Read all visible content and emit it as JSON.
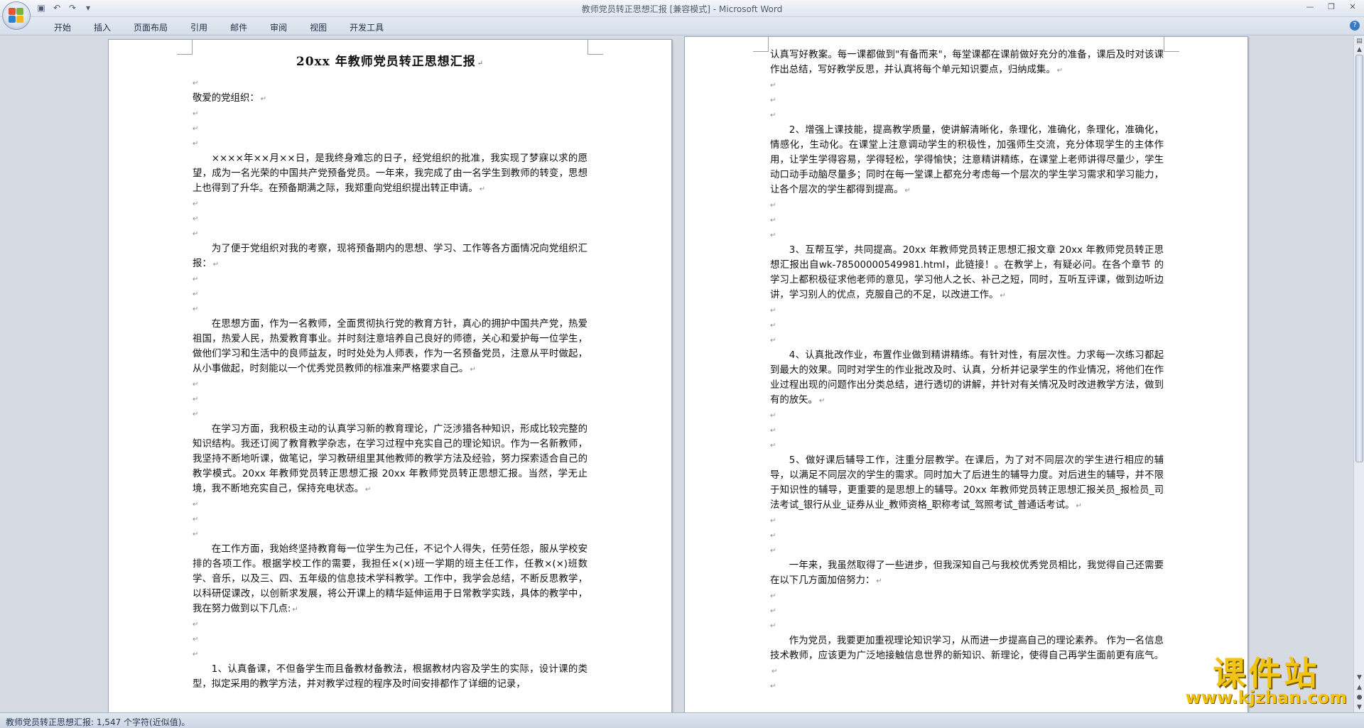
{
  "window": {
    "title": "教师党员转正思想汇报 [兼容模式] - Microsoft Word"
  },
  "quick_access": {
    "icons": [
      "save-icon",
      "undo-icon",
      "redo-icon",
      "customize-icon"
    ]
  },
  "ribbon": {
    "tabs": [
      "开始",
      "插入",
      "页面布局",
      "引用",
      "邮件",
      "审阅",
      "视图",
      "开发工具"
    ]
  },
  "page1": {
    "title": "20xx 年教师党员转正思想汇报",
    "greeting": "敬爱的党组织：",
    "paragraphs": [
      "××××年××月××日，是我终身难忘的日子，经党组织的批准，我实现了梦寐以求的愿望，成为一名光荣的中国共产党预备党员。一年来，我完成了由一名学生到教师的转变，思想上也得到了升华。在预备期满之际，我郑重向党组织提出转正申请。",
      "为了便于党组织对我的考察，现将预备期内的思想、学习、工作等各方面情况向党组织汇报：",
      "在思想方面，作为一名教师，全面贯彻执行党的教育方针，真心的拥护中国共产党，热爱祖国，热爱人民，热爱教育事业。并时刻注意培养自己良好的师德，关心和爱护每一位学生，做他们学习和生活中的良师益友，时时处处为人师表，作为一名预备党员，注意从平时做起，从小事做起，时刻能以一个优秀党员教师的标准来严格要求自己。",
      "在学习方面，我积极主动的认真学习新的教育理论，广泛涉猎各种知识，形成比较完整的知识结构。我还订阅了教育教学杂志，在学习过程中充实自己的理论知识。作为一名新教师，我坚持不断地听课，做笔记，学习教研组里其他教师的教学方法及经验，努力探索适合自己的教学模式。20xx 年教师党员转正思想汇报 20xx 年教师党员转正思想汇报。当然，学无止境，我不断地充实自己，保持充电状态。",
      "在工作方面，我始终坚持教育每一位学生为己任，不记个人得失，任劳任怨，服从学校安排的各项工作。根据学校工作的需要，我担任×(×)班一学期的班主任工作，任教×(×)班数学、音乐，以及三、四、五年级的信息技术学科教学。工作中，我学会总结，不断反思教学，以科研促课改，以创新求发展，将公开课上的精华延伸运用于日常教学实践，具体的教学中，我在努力做到以下几点:",
      "1、认真备课，不但备学生而且备教材备教法，根据教材内容及学生的实际，设计课的类型，拟定采用的教学方法，并对教学过程的程序及时间安排都作了详细的记录，"
    ]
  },
  "page2": {
    "paragraphs": [
      "认真写好教案。每一课都做到\"有备而来\"，每堂课都在课前做好充分的准备，课后及时对该课作出总结，写好教学反思，并认真将每个单元知识要点，归纳成集。",
      "2、增强上课技能，提高教学质量，使讲解清晰化，条理化，准确化，条理化，准确化，情感化，生动化。在课堂上注意调动学生的积极性，加强师生交流，充分体现学生的主体作用，让学生学得容易，学得轻松，学得愉快；注意精讲精练，在课堂上老师讲得尽量少，学生动口动手动脑尽量多；同时在每一堂课上都充分考虑每一个层次的学生学习需求和学习能力，让各个层次的学生都得到提高。",
      "3、互帮互学，共同提高。20xx 年教师党员转正思想汇报文章 20xx 年教师党员转正思想汇报出自wk-78500000549981.html，此链接！。在教学上，有疑必问。在各个章节 的学习上都积极征求他老师的意见，学习他人之长、补己之短，同时，互听互评课，做到边听边讲，学习别人的优点，克服自己的不足，以改进工作。",
      "4、认真批改作业，布置作业做到精讲精练。有针对性，有层次性。力求每一次练习都起到最大的效果。同时对学生的作业批改及时、认真，分析并记录学生的作业情况，将他们在作业过程出现的问题作出分类总结，进行透切的讲解，并针对有关情况及时改进教学方法，做到有的放矢。",
      "5、做好课后辅导工作，注重分层教学。在课后，为了对不同层次的学生进行相应的辅导，以满足不同层次的学生的需求。同时加大了后进生的辅导力度。对后进生的辅导，并不限于知识性的辅导，更重要的是思想上的辅导。20xx 年教师党员转正思想汇报关员_报检员_司法考试_银行从业_证券从业_教师资格_职称考试_驾照考试_普通话考试。",
      "一年来，我虽然取得了一些进步，但我深知自己与我校优秀党员相比，我觉得自己还需要在以下几方面加倍努力：",
      "作为党员，我要更加重视理论知识学习，从而进一步提高自己的理论素养。 作为一名信息技术教师，应该更为广泛地接触信息世界的新知识、新理论，使得自己再学生面前更有底气。"
    ]
  },
  "status_bar": {
    "text": "教师党员转正思想汇报: 1,547 个字符(近似值)。"
  },
  "watermark": {
    "main": "课件站",
    "url": "www.kjzhan.com"
  },
  "marks": {
    "paragraph": "↵"
  }
}
